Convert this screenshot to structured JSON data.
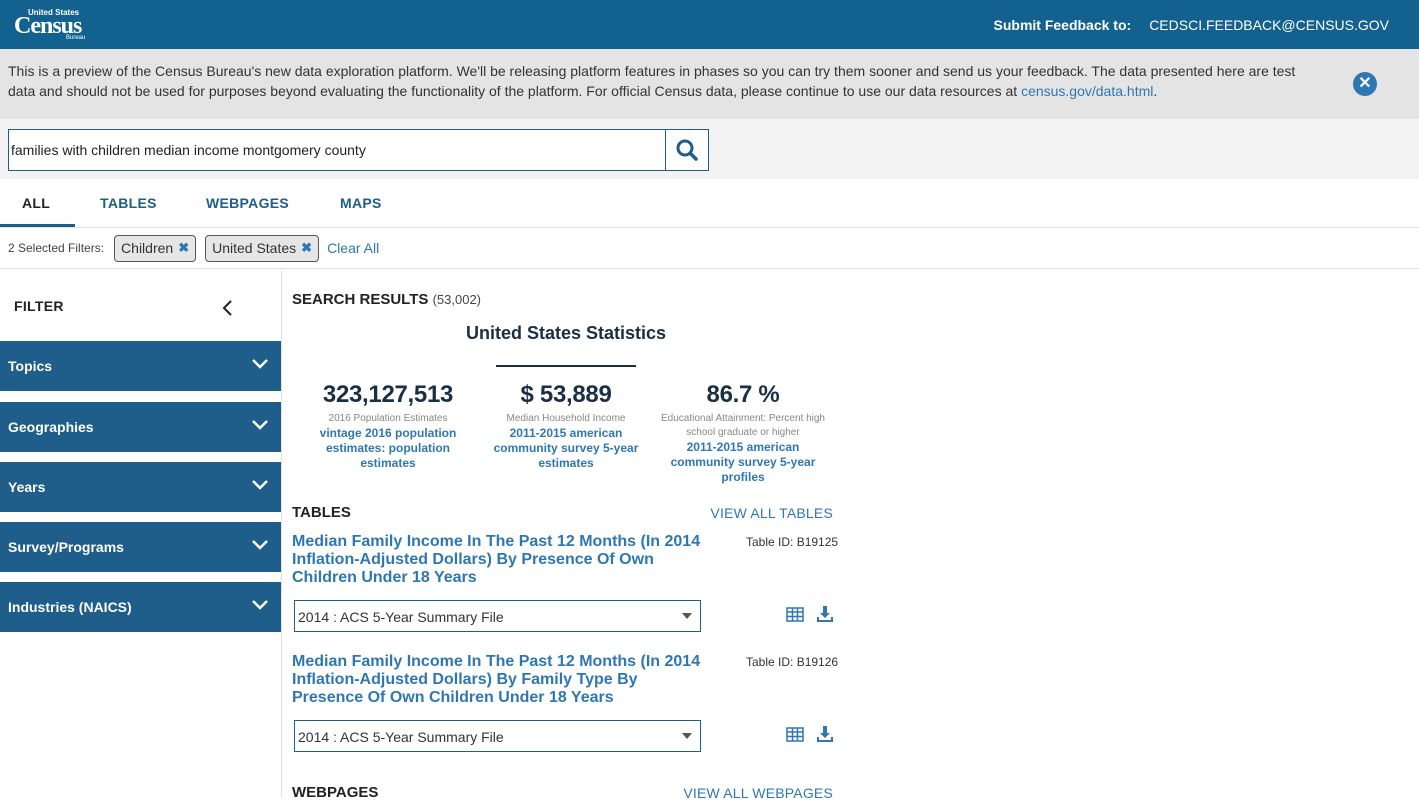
{
  "header": {
    "logo": {
      "top": "United States",
      "main": "Census",
      "bottom": "Bureau"
    },
    "feedback_label": "Submit Feedback to:",
    "feedback_email": "CEDSCI.FEEDBACK@CENSUS.GOV"
  },
  "notice": {
    "text": "This is a preview of the Census Bureau's new data exploration platform. We'll be releasing platform features in phases so you can try them sooner and send us your feedback. The data presented here are test data and should not be used for purposes beyond evaluating the functionality of the platform. For official Census data, please continue to use our data resources at ",
    "link": "census.gov/data.html",
    "after": "."
  },
  "search": {
    "value": "families with children median income montgomery county"
  },
  "tabs": [
    {
      "label": "ALL",
      "active": true
    },
    {
      "label": "TABLES"
    },
    {
      "label": "WEBPAGES"
    },
    {
      "label": "MAPS"
    }
  ],
  "filters": {
    "count_label": "2 Selected Filters:",
    "chips": [
      "Children",
      "United States"
    ],
    "clear_label": "Clear All"
  },
  "sidebar": {
    "title": "FILTER",
    "sections": [
      "Topics",
      "Geographies",
      "Years",
      "Survey/Programs",
      "Industries (NAICS)"
    ]
  },
  "results": {
    "title": "SEARCH RESULTS",
    "count": "(53,002)",
    "stats_title": "United States Statistics",
    "stats": [
      {
        "value": "323,127,513",
        "desc": "2016 Population Estimates",
        "source": "vintage 2016 population estimates: population estimates"
      },
      {
        "value": "$ 53,889",
        "desc": "Median Household Income",
        "source": "2011-2015 american community survey 5-year estimates"
      },
      {
        "value": "86.7 %",
        "desc": "Educational Attainment: Percent high school graduate or higher",
        "source": "2011-2015 american community survey 5-year profiles"
      }
    ],
    "tables_heading": "TABLES",
    "view_all_tables": "VIEW ALL TABLES",
    "tables": [
      {
        "title": "Median Family Income In The Past 12 Months (In 2014 Inflation-Adjusted Dollars) By Presence Of Own Children Under 18 Years",
        "table_id": "Table ID: B19125",
        "dataset": "2014 : ACS 5-Year Summary File"
      },
      {
        "title": "Median Family Income In The Past 12 Months (In 2014 Inflation-Adjusted Dollars) By Family Type By Presence Of Own Children Under 18 Years",
        "table_id": "Table ID: B19126",
        "dataset": "2014 : ACS 5-Year Summary File"
      }
    ],
    "webpages_heading": "WEBPAGES",
    "view_all_webpages": "VIEW ALL WEBPAGES"
  },
  "colors": {
    "header_bg": "#12618f",
    "nav_blue": "#1f5d8a",
    "link_blue": "#2f77b3"
  },
  "icons": [
    "search-icon",
    "close-icon",
    "chevron-left-icon",
    "chevron-down-icon",
    "table-grid-icon",
    "download-icon"
  ]
}
